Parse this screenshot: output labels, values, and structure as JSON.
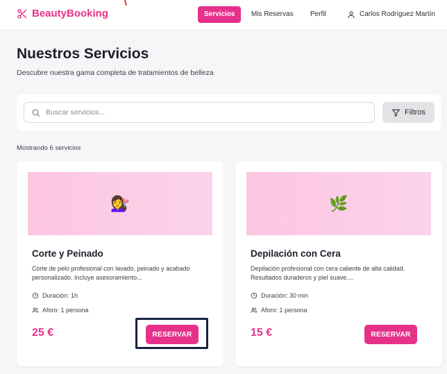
{
  "brand": {
    "name": "BeautyBooking",
    "color": "#e6318b",
    "icon": "scissors-icon"
  },
  "nav": {
    "items": [
      {
        "label": "Servicios",
        "active": true
      },
      {
        "label": "Mis Reservas",
        "active": false
      },
      {
        "label": "Perfil",
        "active": false
      }
    ],
    "user": {
      "name": "Carlos Rodríguez Martín",
      "icon": "user-icon"
    }
  },
  "header": {
    "title": "Nuestros Servicios",
    "subtitle": "Descubre nuestra gama completa de tratamientos de belleza"
  },
  "search": {
    "placeholder": "Buscar servicios...",
    "value": "",
    "icon": "search-icon"
  },
  "filters": {
    "label": "Filtros",
    "icon": "filter-icon"
  },
  "results": {
    "count_text": "Mostrando 6 servicios"
  },
  "services": [
    {
      "title": "Corte y Peinado",
      "description": "Corte de pelo profesional con lavado, peinado y acabado personalizado. Incluye asesoramiento...",
      "duration": "Duración: 1h",
      "capacity": "Aforo: 1 persona",
      "price": "25 €",
      "button": "RESERVAR",
      "emoji": "💇‍♀️"
    },
    {
      "title": "Depilación con Cera",
      "description": "Depilación profesional con cera caliente de alta calidad. Resultados duraderos y piel suave....",
      "duration": "Duración: 30 min",
      "capacity": "Aforo: 1 persona",
      "price": "15 €",
      "button": "RESERVAR",
      "emoji": "🌿"
    }
  ],
  "colors": {
    "accent": "#e6318b",
    "highlight_border": "#15233f",
    "image_bg": "#fdc6e1"
  }
}
